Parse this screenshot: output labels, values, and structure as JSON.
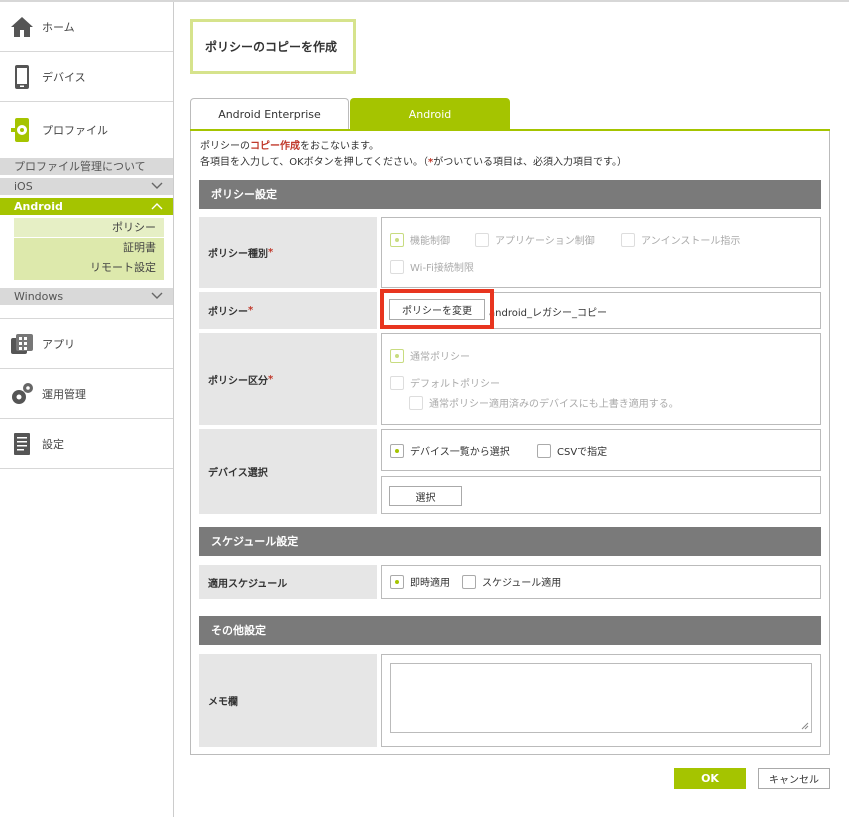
{
  "colors": {
    "accent": "#a5c400",
    "highlight": "#e8351f",
    "required": "#c0392b",
    "section_bg": "#7a7a7a"
  },
  "sidebar": {
    "items": [
      {
        "label": "ホーム",
        "icon": "home-icon"
      },
      {
        "label": "デバイス",
        "icon": "phone-icon"
      },
      {
        "label": "プロファイル",
        "icon": "profile-gear-icon"
      }
    ],
    "profile_sub": {
      "about": "プロファイル管理について",
      "ios": "iOS",
      "android": "Android",
      "android_items": [
        "ポリシー",
        "証明書",
        "リモート設定"
      ],
      "windows": "Windows"
    },
    "bottom_items": [
      {
        "label": "アプリ",
        "icon": "app-icon"
      },
      {
        "label": "運用管理",
        "icon": "gears-icon"
      },
      {
        "label": "設定",
        "icon": "document-icon"
      }
    ]
  },
  "page_title": "ポリシーのコピーを作成",
  "tabs": [
    "Android Enterprise",
    "Android"
  ],
  "intro": {
    "line1_a": "ポリシーの",
    "line1_red": "コピー作成",
    "line1_b": "をおこないます。",
    "line2_a": "各項目を入力して、OKボタンを押してください。（",
    "line2_star": "*",
    "line2_b": "がついている項目は、必須入力項目です。）"
  },
  "sections": {
    "policy_settings": "ポリシー設定",
    "schedule_settings": "スケジュール設定",
    "other_settings": "その他設定"
  },
  "fields": {
    "policy_type": {
      "label": "ポリシー種別",
      "options": [
        "機能制御",
        "アプリケーション制御",
        "アンインストール指示",
        "Wi-Fi接続制限"
      ]
    },
    "policy": {
      "label": "ポリシー",
      "button": "ポリシーを変更",
      "value": "android_レガシー_コピー"
    },
    "policy_category": {
      "label": "ポリシー区分",
      "options": [
        "通常ポリシー",
        "デフォルトポリシー",
        "通常ポリシー適用済みのデバイスにも上書き適用する。"
      ]
    },
    "device_select": {
      "label": "デバイス選択",
      "options": [
        "デバイス一覧から選択",
        "CSVで指定"
      ],
      "button": "選択"
    },
    "schedule": {
      "label": "適用スケジュール",
      "options": [
        "即時適用",
        "スケジュール適用"
      ]
    },
    "memo": {
      "label": "メモ欄",
      "value": ""
    }
  },
  "star": "*",
  "buttons": {
    "ok": "OK",
    "cancel": "キャンセル"
  }
}
